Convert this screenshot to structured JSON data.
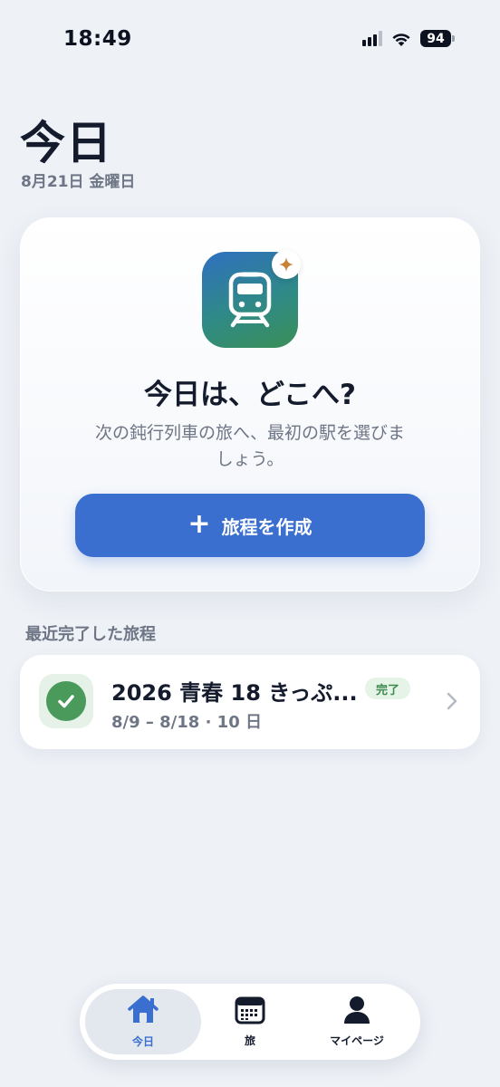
{
  "status_bar": {
    "time": "18:49",
    "battery": "94"
  },
  "header": {
    "title": "今日",
    "date": "8月21日 金曜日"
  },
  "hero": {
    "icon": "train-icon",
    "badge_icon": "sparkle-icon",
    "title": "今日は、どこへ?",
    "description": "次の鈍行列車の旅へ、最初の駅を選びましょう。",
    "button_label": "旅程を作成"
  },
  "recent": {
    "section_title": "最近完了した旅程",
    "items": [
      {
        "name": "2026 青春 18 きっぷ...",
        "dates": "8/9 – 8/18 · 10 日",
        "status": "完了"
      }
    ]
  },
  "tab_bar": {
    "tabs": [
      {
        "label": "今日",
        "icon": "home-icon",
        "selected": true
      },
      {
        "label": "旅",
        "icon": "calendar-icon",
        "selected": false
      },
      {
        "label": "マイページ",
        "icon": "person-icon",
        "selected": false
      }
    ]
  },
  "colors": {
    "background": "#eef1f6",
    "accent": "#3a6fd0",
    "success": "#4a9a5c",
    "text_primary": "#141b2d",
    "text_secondary": "#6e7686"
  }
}
